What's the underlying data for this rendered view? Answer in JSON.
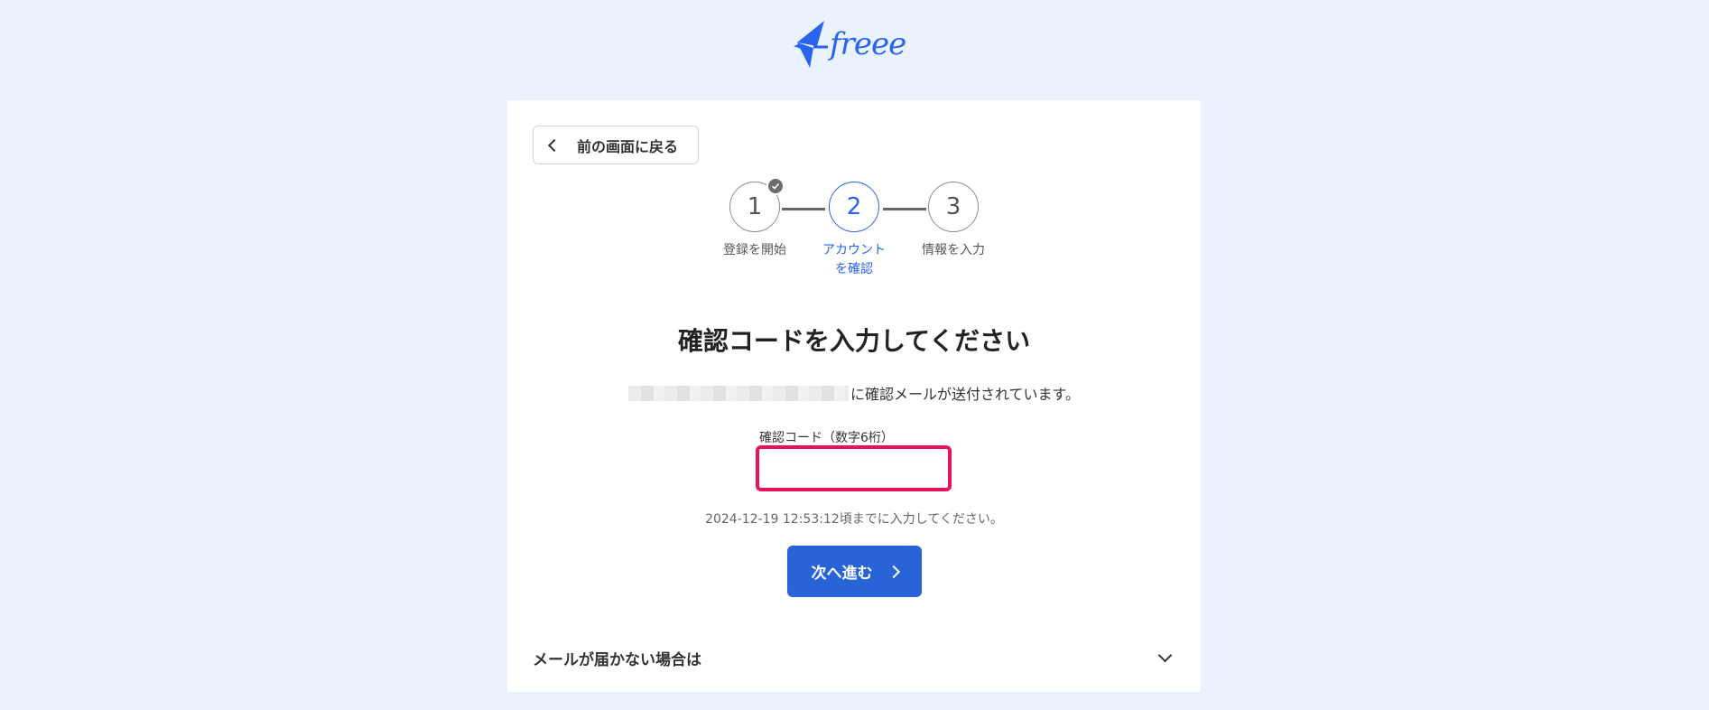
{
  "brand": {
    "logo_text": "freee",
    "color": "#2864f0"
  },
  "back_button": {
    "label": "前の画面に戻る",
    "icon": "chevron-left-icon"
  },
  "stepper": {
    "steps": [
      {
        "number": "1",
        "label": "登録を開始",
        "state": "completed"
      },
      {
        "number": "2",
        "label_line1": "アカウント",
        "label_line2": "を確認",
        "state": "active"
      },
      {
        "number": "3",
        "label": "情報を入力",
        "state": "pending"
      }
    ]
  },
  "main": {
    "title": "確認コードを入力してください",
    "sent_message": "に確認メールが送付されています。",
    "code_field": {
      "label": "確認コード（数字6桁）",
      "value": "",
      "placeholder": ""
    },
    "deadline": "2024-12-19 12:53:12頃までに入力してください。",
    "next_button": {
      "label": "次へ進む",
      "icon": "chevron-right-icon",
      "color": "#2864d8"
    }
  },
  "faq": {
    "label": "メールが届かない場合は",
    "icon": "chevron-down-icon"
  },
  "colors": {
    "background": "#eaf2fe",
    "highlight": "#e8125c",
    "accent": "#2864f0"
  }
}
